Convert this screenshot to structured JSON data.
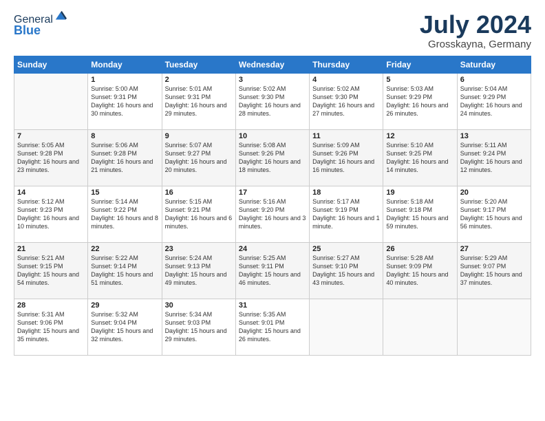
{
  "header": {
    "logo_general": "General",
    "logo_blue": "Blue",
    "title": "July 2024",
    "subtitle": "Grosskayna, Germany"
  },
  "days_header": [
    "Sunday",
    "Monday",
    "Tuesday",
    "Wednesday",
    "Thursday",
    "Friday",
    "Saturday"
  ],
  "weeks": [
    [
      {
        "num": "",
        "sunrise": "",
        "sunset": "",
        "daylight": ""
      },
      {
        "num": "1",
        "sunrise": "Sunrise: 5:00 AM",
        "sunset": "Sunset: 9:31 PM",
        "daylight": "Daylight: 16 hours and 30 minutes."
      },
      {
        "num": "2",
        "sunrise": "Sunrise: 5:01 AM",
        "sunset": "Sunset: 9:31 PM",
        "daylight": "Daylight: 16 hours and 29 minutes."
      },
      {
        "num": "3",
        "sunrise": "Sunrise: 5:02 AM",
        "sunset": "Sunset: 9:30 PM",
        "daylight": "Daylight: 16 hours and 28 minutes."
      },
      {
        "num": "4",
        "sunrise": "Sunrise: 5:02 AM",
        "sunset": "Sunset: 9:30 PM",
        "daylight": "Daylight: 16 hours and 27 minutes."
      },
      {
        "num": "5",
        "sunrise": "Sunrise: 5:03 AM",
        "sunset": "Sunset: 9:29 PM",
        "daylight": "Daylight: 16 hours and 26 minutes."
      },
      {
        "num": "6",
        "sunrise": "Sunrise: 5:04 AM",
        "sunset": "Sunset: 9:29 PM",
        "daylight": "Daylight: 16 hours and 24 minutes."
      }
    ],
    [
      {
        "num": "7",
        "sunrise": "Sunrise: 5:05 AM",
        "sunset": "Sunset: 9:28 PM",
        "daylight": "Daylight: 16 hours and 23 minutes."
      },
      {
        "num": "8",
        "sunrise": "Sunrise: 5:06 AM",
        "sunset": "Sunset: 9:28 PM",
        "daylight": "Daylight: 16 hours and 21 minutes."
      },
      {
        "num": "9",
        "sunrise": "Sunrise: 5:07 AM",
        "sunset": "Sunset: 9:27 PM",
        "daylight": "Daylight: 16 hours and 20 minutes."
      },
      {
        "num": "10",
        "sunrise": "Sunrise: 5:08 AM",
        "sunset": "Sunset: 9:26 PM",
        "daylight": "Daylight: 16 hours and 18 minutes."
      },
      {
        "num": "11",
        "sunrise": "Sunrise: 5:09 AM",
        "sunset": "Sunset: 9:26 PM",
        "daylight": "Daylight: 16 hours and 16 minutes."
      },
      {
        "num": "12",
        "sunrise": "Sunrise: 5:10 AM",
        "sunset": "Sunset: 9:25 PM",
        "daylight": "Daylight: 16 hours and 14 minutes."
      },
      {
        "num": "13",
        "sunrise": "Sunrise: 5:11 AM",
        "sunset": "Sunset: 9:24 PM",
        "daylight": "Daylight: 16 hours and 12 minutes."
      }
    ],
    [
      {
        "num": "14",
        "sunrise": "Sunrise: 5:12 AM",
        "sunset": "Sunset: 9:23 PM",
        "daylight": "Daylight: 16 hours and 10 minutes."
      },
      {
        "num": "15",
        "sunrise": "Sunrise: 5:14 AM",
        "sunset": "Sunset: 9:22 PM",
        "daylight": "Daylight: 16 hours and 8 minutes."
      },
      {
        "num": "16",
        "sunrise": "Sunrise: 5:15 AM",
        "sunset": "Sunset: 9:21 PM",
        "daylight": "Daylight: 16 hours and 6 minutes."
      },
      {
        "num": "17",
        "sunrise": "Sunrise: 5:16 AM",
        "sunset": "Sunset: 9:20 PM",
        "daylight": "Daylight: 16 hours and 3 minutes."
      },
      {
        "num": "18",
        "sunrise": "Sunrise: 5:17 AM",
        "sunset": "Sunset: 9:19 PM",
        "daylight": "Daylight: 16 hours and 1 minute."
      },
      {
        "num": "19",
        "sunrise": "Sunrise: 5:18 AM",
        "sunset": "Sunset: 9:18 PM",
        "daylight": "Daylight: 15 hours and 59 minutes."
      },
      {
        "num": "20",
        "sunrise": "Sunrise: 5:20 AM",
        "sunset": "Sunset: 9:17 PM",
        "daylight": "Daylight: 15 hours and 56 minutes."
      }
    ],
    [
      {
        "num": "21",
        "sunrise": "Sunrise: 5:21 AM",
        "sunset": "Sunset: 9:15 PM",
        "daylight": "Daylight: 15 hours and 54 minutes."
      },
      {
        "num": "22",
        "sunrise": "Sunrise: 5:22 AM",
        "sunset": "Sunset: 9:14 PM",
        "daylight": "Daylight: 15 hours and 51 minutes."
      },
      {
        "num": "23",
        "sunrise": "Sunrise: 5:24 AM",
        "sunset": "Sunset: 9:13 PM",
        "daylight": "Daylight: 15 hours and 49 minutes."
      },
      {
        "num": "24",
        "sunrise": "Sunrise: 5:25 AM",
        "sunset": "Sunset: 9:11 PM",
        "daylight": "Daylight: 15 hours and 46 minutes."
      },
      {
        "num": "25",
        "sunrise": "Sunrise: 5:27 AM",
        "sunset": "Sunset: 9:10 PM",
        "daylight": "Daylight: 15 hours and 43 minutes."
      },
      {
        "num": "26",
        "sunrise": "Sunrise: 5:28 AM",
        "sunset": "Sunset: 9:09 PM",
        "daylight": "Daylight: 15 hours and 40 minutes."
      },
      {
        "num": "27",
        "sunrise": "Sunrise: 5:29 AM",
        "sunset": "Sunset: 9:07 PM",
        "daylight": "Daylight: 15 hours and 37 minutes."
      }
    ],
    [
      {
        "num": "28",
        "sunrise": "Sunrise: 5:31 AM",
        "sunset": "Sunset: 9:06 PM",
        "daylight": "Daylight: 15 hours and 35 minutes."
      },
      {
        "num": "29",
        "sunrise": "Sunrise: 5:32 AM",
        "sunset": "Sunset: 9:04 PM",
        "daylight": "Daylight: 15 hours and 32 minutes."
      },
      {
        "num": "30",
        "sunrise": "Sunrise: 5:34 AM",
        "sunset": "Sunset: 9:03 PM",
        "daylight": "Daylight: 15 hours and 29 minutes."
      },
      {
        "num": "31",
        "sunrise": "Sunrise: 5:35 AM",
        "sunset": "Sunset: 9:01 PM",
        "daylight": "Daylight: 15 hours and 26 minutes."
      },
      {
        "num": "",
        "sunrise": "",
        "sunset": "",
        "daylight": ""
      },
      {
        "num": "",
        "sunrise": "",
        "sunset": "",
        "daylight": ""
      },
      {
        "num": "",
        "sunrise": "",
        "sunset": "",
        "daylight": ""
      }
    ]
  ]
}
